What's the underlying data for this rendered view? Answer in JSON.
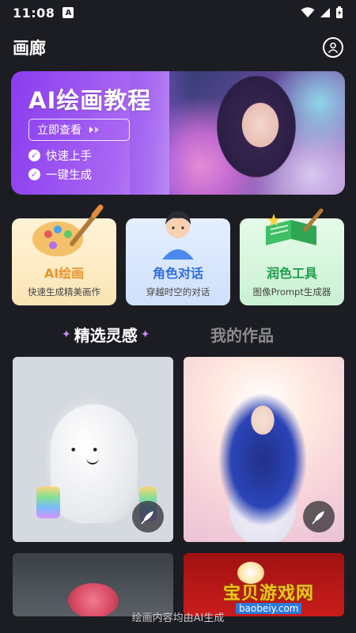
{
  "status_bar": {
    "time": "11:08",
    "notif_badge": "A"
  },
  "header": {
    "title": "画廊"
  },
  "banner": {
    "headline": "AI绘画教程",
    "cta_label": "立即查看",
    "features": [
      "快速上手",
      "一键生成"
    ]
  },
  "cards": [
    {
      "title": "AI绘画",
      "subtitle": "快速生成精美画作"
    },
    {
      "title": "角色对话",
      "subtitle": "穿越时空的对话"
    },
    {
      "title": "润色工具",
      "subtitle": "图像Prompt生成器"
    }
  ],
  "tabs": {
    "active": "精选灵感",
    "inactive": "我的作品"
  },
  "watermark": {
    "title": "宝贝游戏网",
    "url": "baobeiy.com"
  },
  "footer_note": "绘画内容均由AI生成",
  "colors": {
    "background": "#1c1d22",
    "banner_purple": "#8a3df0",
    "card_orange": "#e7952a",
    "card_blue": "#2f6ee0",
    "card_green": "#1a9e4a"
  }
}
